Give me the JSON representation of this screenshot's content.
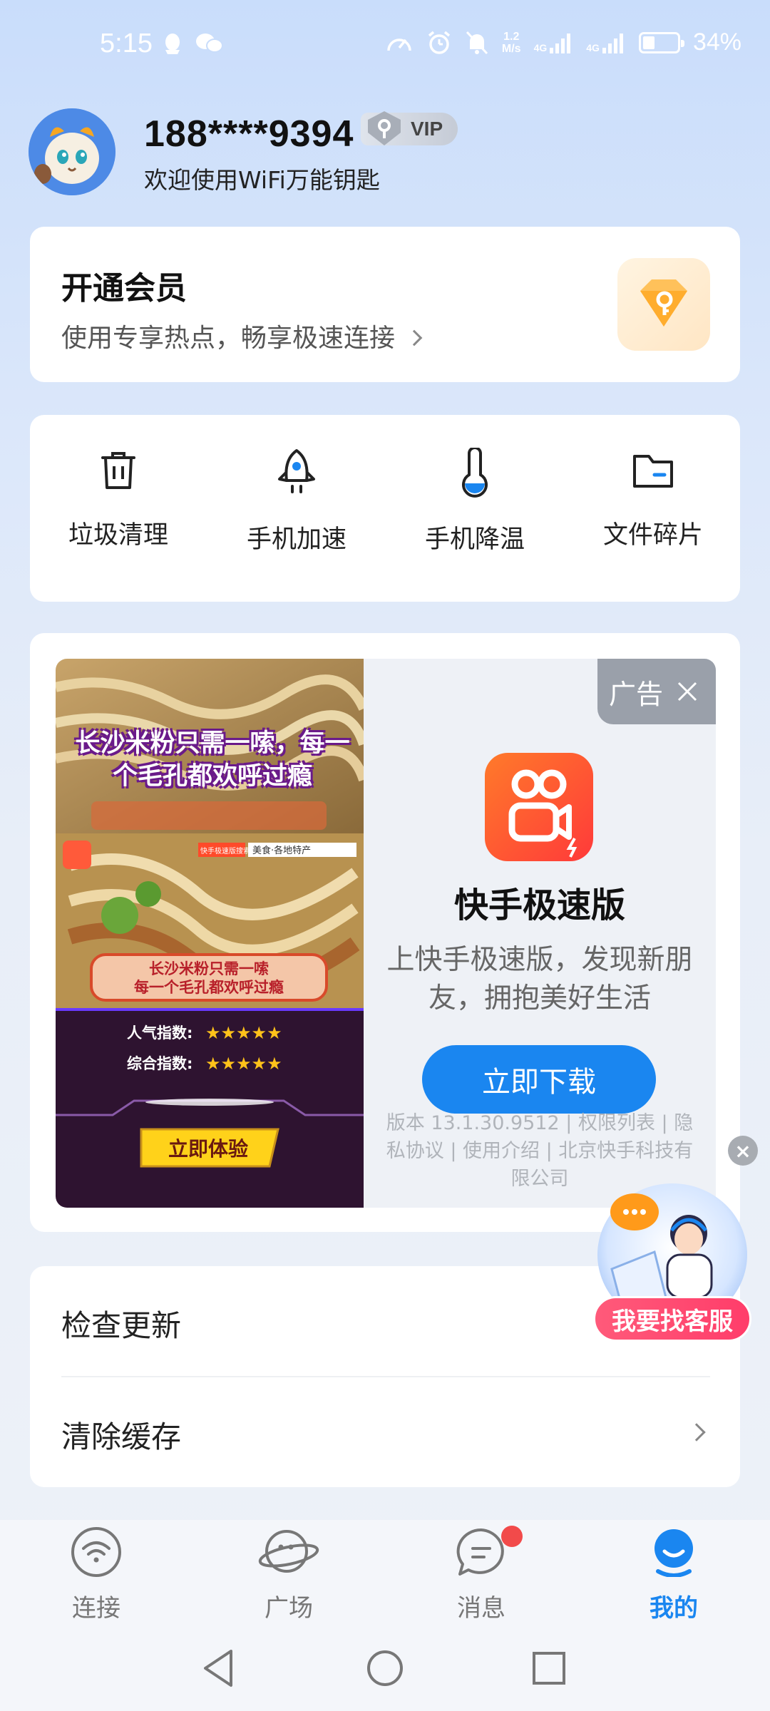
{
  "status_bar": {
    "time": "5:15",
    "net_speed_top": "1.2",
    "net_speed_bottom": "M/s",
    "signal_1": "4G",
    "signal_2": "4G",
    "battery_percent": "34%",
    "battery_level": 0.34
  },
  "profile": {
    "phone": "188****9394",
    "vip_label": "VIP",
    "welcome": "欢迎使用WiFi万能钥匙"
  },
  "membership": {
    "title": "开通会员",
    "subtitle": "使用专享热点，畅享极速连接"
  },
  "tools": [
    {
      "label": "垃圾清理",
      "icon": "trash-icon"
    },
    {
      "label": "手机加速",
      "icon": "rocket-icon"
    },
    {
      "label": "手机降温",
      "icon": "thermometer-icon"
    },
    {
      "label": "文件碎片",
      "icon": "folder-icon"
    }
  ],
  "ad": {
    "tag": "广告",
    "image_headline": "长沙米粉只需一嗦，每一个毛孔都欢呼过瘾",
    "image_banner_line1": "长沙米粉只需一嗦",
    "image_banner_line2": "每一个毛孔都欢呼过瘾",
    "image_rating1_label": "人气指数:",
    "image_rating2_label": "综合指数:",
    "image_rating1_stars": 5,
    "image_rating2_stars": 5,
    "image_cta": "立即体验",
    "image_search_text": "美食·各地特产",
    "image_brand_text": "快手极速版搜索",
    "app_name": "快手极速版",
    "app_desc": "上快手极速版，发现新朋友，拥抱美好生活",
    "download_label": "立即下载",
    "app_meta": "版本 13.1.30.9512 | 权限列表 | 隐私协议 | 使用介绍 | 北京快手科技有限公司"
  },
  "customer_service": {
    "label": "我要找客服"
  },
  "settings": [
    {
      "label": "检查更新"
    },
    {
      "label": "清除缓存"
    }
  ],
  "bottom_nav": [
    {
      "label": "连接",
      "icon": "wifi-icon",
      "active": false
    },
    {
      "label": "广场",
      "icon": "plaza-icon",
      "active": false
    },
    {
      "label": "消息",
      "icon": "message-icon",
      "active": false
    },
    {
      "label": "我的",
      "icon": "profile-icon",
      "active": true
    }
  ],
  "colors": {
    "accent": "#1a86f0",
    "badge_red": "#f24a4a",
    "cs_pink": "#ff3d6a"
  }
}
